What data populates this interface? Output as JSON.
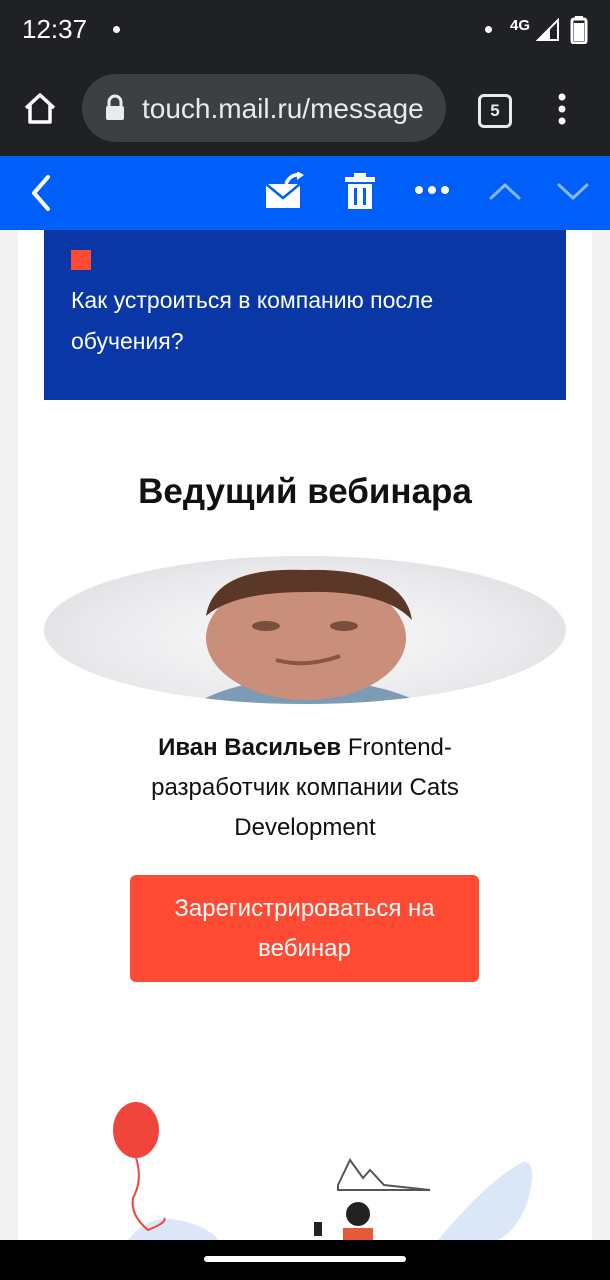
{
  "status_bar": {
    "time": "12:37",
    "network": "4G"
  },
  "browser": {
    "url": "touch.mail.ru/message",
    "tab_count": "5"
  },
  "mail_toolbar": {
    "icons": [
      "back-icon",
      "forward-mail-icon",
      "trash-icon",
      "more-icon",
      "previous-icon",
      "next-icon"
    ]
  },
  "email": {
    "banner_text": "Как устроиться в компанию после обучения?",
    "speaker_heading": "Ведущий вебинара",
    "speaker_name": "Иван Васильев",
    "speaker_role": "Frontend-разработчик компании Cats Development",
    "register_button": "Зарегистрироваться на вебинар"
  },
  "colors": {
    "toolbar": "#005ff9",
    "banner": "#0a37a6",
    "accent": "#ff4b33"
  }
}
